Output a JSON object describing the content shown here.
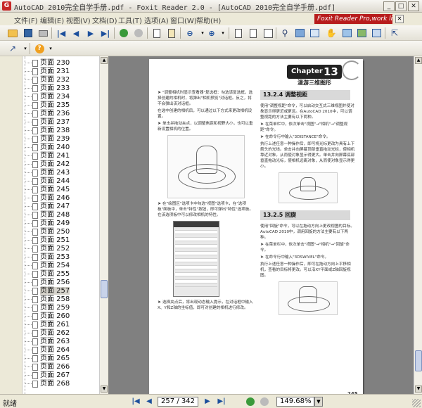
{
  "window": {
    "title": "AutoCAD 2010完全自学手册.pdf - Foxit Reader 2.0 - [AutoCAD 2010完全自学手册.pdf]"
  },
  "menu": {
    "items": [
      "文件(F)",
      "编辑(E)",
      "视图(V)",
      "文档(D)",
      "工具(T)",
      "选项(A)",
      "窗口(W)",
      "帮助(H)"
    ],
    "banner": "Foxit Reader Pro,work like a pro!"
  },
  "toolbar1": {
    "icons": [
      "open-icon",
      "save-icon",
      "print-icon",
      "first-page-icon",
      "previous-page-icon",
      "next-page-icon",
      "last-page-icon",
      "go-back-icon",
      "go-forward-icon",
      "copy-icon",
      "paste-icon",
      "zoom-out-icon",
      "zoom-in-icon",
      "single-page-icon",
      "continuous-icon",
      "facing-icon",
      "binoculars-icon",
      "text-view-icon",
      "table-icon",
      "hand-tool-icon",
      "snapshot-icon",
      "image-icon",
      "grid-icon",
      "select-icon"
    ]
  },
  "toolbar2": {
    "icons": [
      "select-arrow-icon",
      "help-icon"
    ]
  },
  "sidebar": {
    "pages": [
      "页面 230",
      "页面 231",
      "页面 232",
      "页面 233",
      "页面 234",
      "页面 235",
      "页面 236",
      "页面 237",
      "页面 238",
      "页面 239",
      "页面 240",
      "页面 241",
      "页面 242",
      "页面 243",
      "页面 244",
      "页面 245",
      "页面 246",
      "页面 247",
      "页面 248",
      "页面 249",
      "页面 250",
      "页面 251",
      "页面 252",
      "页面 253",
      "页面 254",
      "页面 255",
      "页面 256",
      "页面 257",
      "页面 258",
      "页面 259",
      "页面 260",
      "页面 261",
      "页面 262",
      "页面 263",
      "页面 264",
      "页面 265",
      "页面 266",
      "页面 267",
      "页面 268"
    ],
    "selected": "页面 257"
  },
  "document": {
    "chapter_word": "Chapter",
    "chapter_num": "13",
    "chapter_subtitle": "漫游三维图形",
    "left_paras": [
      "\"调整相机时显示查看器\"复选框：勾选该复选框，选择创建的相机时，将弹出\"相机预览\"对话框。反之，将不会弹出该对话框。",
      "在选中创建的相机后，可以通过以下方式来更改相机设置。",
      "单击并拖动夹点，以调整焦距和视野大小，也可以重新设置相机的位置。"
    ],
    "left_paras2": [
      "在\"绘图区\"选项卡中勾选\"视图\"选项卡，在\"选项板\"面板中，单击\"特性\"按钮，即可弹出\"特性\"选项板。在该选项板中可以修改相机的特性。"
    ],
    "left_paras3": [
      "选择夹点后，将出现动态输入提示，在对话框中输入X、Y和Z轴的坐标值，即可对创建的相机进行修改。"
    ],
    "sec1_title": "13.2.4 调整视距",
    "sec1_paras": [
      "使用\"调整视距\"命令，可以启动交互式三维视图并使对象显示得更近或更远。在AutoCAD 2010中，可以调整视距的方法主要有以下两种。",
      "在菜单栏中，依次单击\"视图\"→\"相机\"→\"调整视距\"命令。",
      "在命令行中输入\"3DISTANCE\"命令。",
      "执行上述任意一种操作后，即可将光标更改为具有上下箭头的光线。单击并向屏幕顶部垂直拖动光标，使相机靠近对象，从而使对象显示得更大。单击并向屏幕底部垂直拖动光标，使相机远离对象，从而使对象显示得更小。"
    ],
    "sec2_title": "13.2.5 回旋",
    "sec2_paras": [
      "使用\"回旋\"命令，可以在拖动方向上更改视图的目标。AutoCAD 2010中，调用回旋的方法主要有以下两种。",
      "在菜单栏中，依次单击\"视图\"→\"相机\"→\"回旋\"命令。",
      "在命令行中输入\"3DSWIVEL\"命令。",
      "执行上述任意一种操作后，即可在拖动方向上平移相机，查看的目标将更改。可以沿XY平面或Z轴回旋视图。"
    ],
    "page_number": "245"
  },
  "statusbar": {
    "status": "就绪",
    "page_display": "257 / 342",
    "zoom": "149.68%"
  }
}
